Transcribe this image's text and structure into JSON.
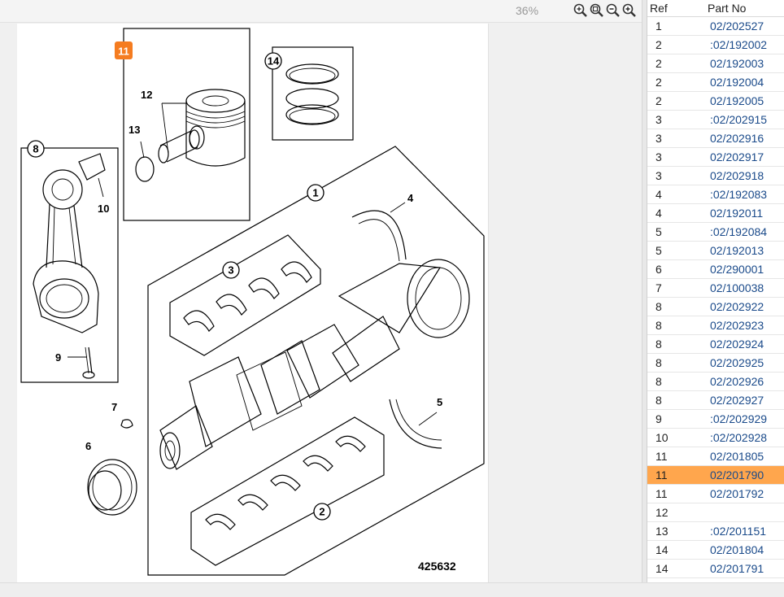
{
  "toolbar": {
    "zoom_level": "36%",
    "zoom_fit_icon": "zoom-fit-icon",
    "zoom_reset_icon": "zoom-reset-icon",
    "zoom_out_icon": "zoom-out-icon",
    "zoom_in_icon": "zoom-in-icon"
  },
  "diagram": {
    "drawing_number": "425632",
    "callouts": {
      "c1": "1",
      "c2": "2",
      "c3": "3",
      "c4": "4",
      "c5": "5",
      "c6": "6",
      "c7": "7",
      "c8": "8",
      "c9": "9",
      "c10": "10",
      "c11": "11",
      "c12": "12",
      "c13": "13",
      "c14": "14"
    },
    "highlight_color": "#f57c20"
  },
  "parts_table": {
    "headers": {
      "ref": "Ref",
      "part_no": "Part No"
    },
    "selected_color": "#ffa64d",
    "rows": [
      {
        "ref": "1",
        "part_no": "02/202527"
      },
      {
        "ref": "2",
        "part_no": ":02/192002"
      },
      {
        "ref": "2",
        "part_no": "02/192003"
      },
      {
        "ref": "2",
        "part_no": "02/192004"
      },
      {
        "ref": "2",
        "part_no": "02/192005"
      },
      {
        "ref": "3",
        "part_no": ":02/202915"
      },
      {
        "ref": "3",
        "part_no": "02/202916"
      },
      {
        "ref": "3",
        "part_no": "02/202917"
      },
      {
        "ref": "3",
        "part_no": "02/202918"
      },
      {
        "ref": "4",
        "part_no": ":02/192083"
      },
      {
        "ref": "4",
        "part_no": "02/192011"
      },
      {
        "ref": "5",
        "part_no": ":02/192084"
      },
      {
        "ref": "5",
        "part_no": "02/192013"
      },
      {
        "ref": "6",
        "part_no": "02/290001"
      },
      {
        "ref": "7",
        "part_no": "02/100038"
      },
      {
        "ref": "8",
        "part_no": "02/202922"
      },
      {
        "ref": "8",
        "part_no": "02/202923"
      },
      {
        "ref": "8",
        "part_no": "02/202924"
      },
      {
        "ref": "8",
        "part_no": "02/202925"
      },
      {
        "ref": "8",
        "part_no": "02/202926"
      },
      {
        "ref": "8",
        "part_no": "02/202927"
      },
      {
        "ref": "9",
        "part_no": ":02/202929"
      },
      {
        "ref": "10",
        "part_no": ":02/202928"
      },
      {
        "ref": "11",
        "part_no": "02/201805"
      },
      {
        "ref": "11",
        "part_no": "02/201790",
        "selected": true
      },
      {
        "ref": "11",
        "part_no": "02/201792"
      },
      {
        "ref": "12",
        "part_no": ""
      },
      {
        "ref": "13",
        "part_no": ":02/201151"
      },
      {
        "ref": "14",
        "part_no": "02/201804"
      },
      {
        "ref": "14",
        "part_no": "02/201791"
      }
    ]
  }
}
